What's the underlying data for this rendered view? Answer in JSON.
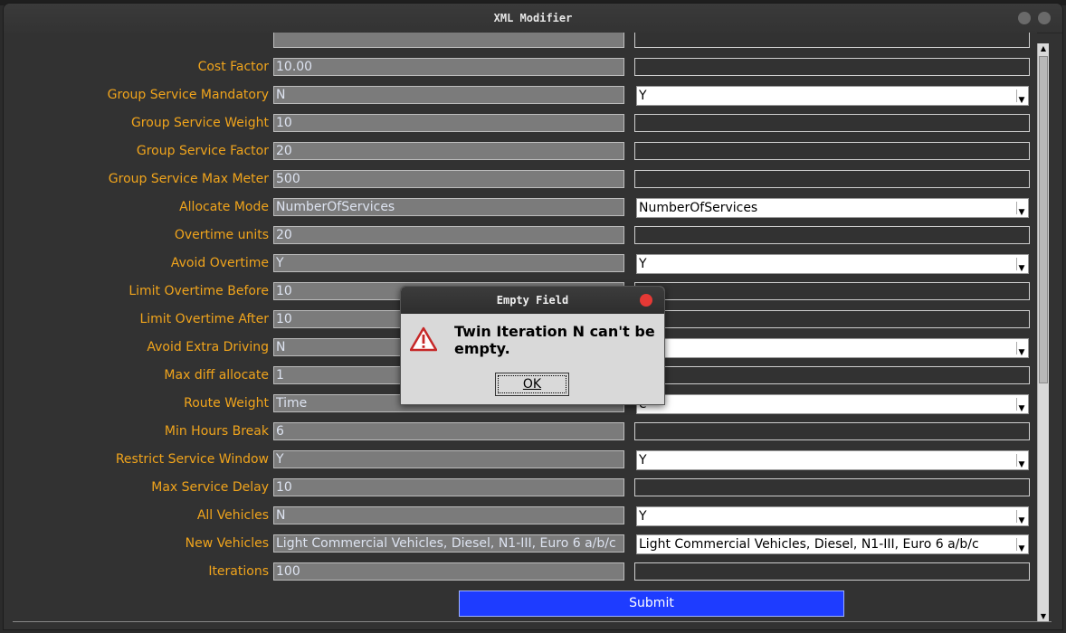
{
  "window": {
    "title": "XML Modifier"
  },
  "fields": [
    {
      "label": "Cost Factor",
      "old_value": "10.00",
      "type": "text",
      "new_value": ""
    },
    {
      "label": "Group Service Mandatory",
      "old_value": "N",
      "type": "select",
      "new_value": "Y"
    },
    {
      "label": "Group Service Weight",
      "old_value": "10",
      "type": "text",
      "new_value": ""
    },
    {
      "label": "Group Service Factor",
      "old_value": "20",
      "type": "text",
      "new_value": ""
    },
    {
      "label": "Group Service Max Meter",
      "old_value": "500",
      "type": "text",
      "new_value": ""
    },
    {
      "label": "Allocate Mode",
      "old_value": "NumberOfServices",
      "type": "select",
      "new_value": "NumberOfServices"
    },
    {
      "label": "Overtime units",
      "old_value": "20",
      "type": "text",
      "new_value": ""
    },
    {
      "label": "Avoid Overtime",
      "old_value": "Y",
      "type": "select",
      "new_value": "Y"
    },
    {
      "label": "Limit Overtime Before",
      "old_value": "10",
      "type": "text",
      "new_value": ""
    },
    {
      "label": "Limit Overtime After",
      "old_value": "10",
      "type": "text",
      "new_value": ""
    },
    {
      "label": "Avoid Extra Driving",
      "old_value": "N",
      "type": "select",
      "new_value": ""
    },
    {
      "label": "Max diff allocate",
      "old_value": "1",
      "type": "text",
      "new_value": ""
    },
    {
      "label": "Route Weight",
      "old_value": "Time",
      "type": "select",
      "new_value": "e"
    },
    {
      "label": "Min Hours Break",
      "old_value": "6",
      "type": "text",
      "new_value": ""
    },
    {
      "label": "Restrict Service Window",
      "old_value": "Y",
      "type": "select",
      "new_value": "Y"
    },
    {
      "label": "Max Service Delay",
      "old_value": "10",
      "type": "text",
      "new_value": ""
    },
    {
      "label": "All Vehicles",
      "old_value": "N",
      "type": "select",
      "new_value": "Y"
    },
    {
      "label": "New Vehicles",
      "old_value": "Light Commercial Vehicles, Diesel, N1-III, Euro 6 a/b/c",
      "type": "select",
      "new_value": "Light Commercial Vehicles, Diesel, N1-III, Euro 6 a/b/c"
    },
    {
      "label": "Iterations",
      "old_value": "100",
      "type": "text",
      "new_value": ""
    }
  ],
  "submit_label": "Submit",
  "dialog": {
    "title": "Empty Field",
    "message": "Twin Iteration N can't be empty.",
    "ok_label": "OK"
  },
  "icons": {
    "warning": "warning-icon",
    "dropdown": "chevron-down-icon"
  },
  "colors": {
    "label": "#f0a41c",
    "submit": "#1e3cff",
    "close": "#e53935"
  }
}
